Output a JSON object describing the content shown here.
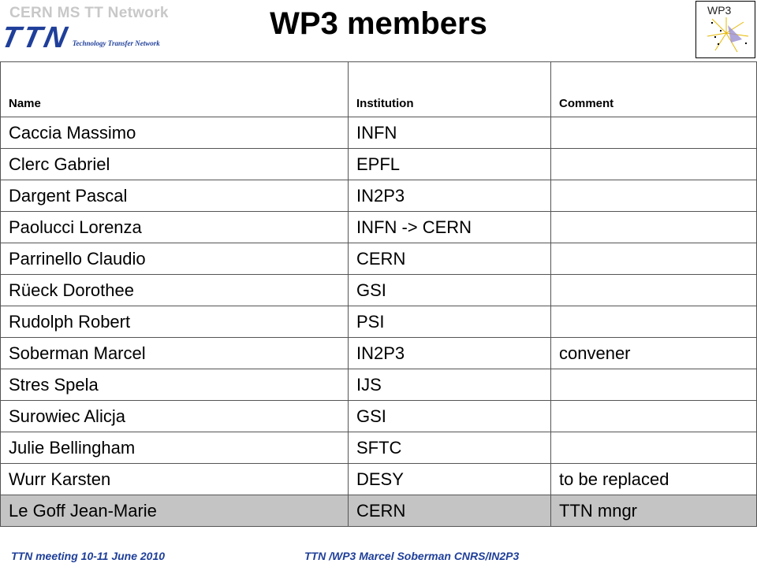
{
  "header": {
    "network": "CERN MS TT Network",
    "logo_letters": "TTN",
    "logo_subtitle": "Technology Transfer Network",
    "title": "WP3 members",
    "badge": "WP3"
  },
  "table": {
    "headers": [
      "Name",
      "Institution",
      "Comment"
    ],
    "rows": [
      {
        "name": "Caccia Massimo",
        "institution": "INFN",
        "comment": ""
      },
      {
        "name": "Clerc Gabriel",
        "institution": "EPFL",
        "comment": ""
      },
      {
        "name": "Dargent Pascal",
        "institution": "IN2P3",
        "comment": ""
      },
      {
        "name": "Paolucci Lorenza",
        "institution": "INFN -> CERN",
        "comment": ""
      },
      {
        "name": "Parrinello Claudio",
        "institution": "CERN",
        "comment": ""
      },
      {
        "name": "Rüeck Dorothee",
        "institution": "GSI",
        "comment": ""
      },
      {
        "name": "Rudolph Robert",
        "institution": "PSI",
        "comment": ""
      },
      {
        "name": "Soberman Marcel",
        "institution": "IN2P3",
        "comment": "convener"
      },
      {
        "name": "Stres Spela",
        "institution": "IJS",
        "comment": ""
      },
      {
        "name": "Surowiec Alicja",
        "institution": "GSI",
        "comment": ""
      },
      {
        "name": "Julie Bellingham",
        "institution": "SFTC",
        "comment": ""
      },
      {
        "name": "Wurr Karsten",
        "institution": "DESY",
        "comment": "to be replaced"
      },
      {
        "name": "Le Goff Jean-Marie",
        "institution": "CERN",
        "comment": "TTN mngr"
      }
    ]
  },
  "footer": {
    "left": "TTN meeting 10-11 June 2010",
    "right": "TTN /WP3 Marcel Soberman CNRS/IN2P3"
  },
  "colors": {
    "brand_blue": "#1f3f9a",
    "highlight_row": "#c4c4c4",
    "network_grey": "#c8c8c8"
  }
}
